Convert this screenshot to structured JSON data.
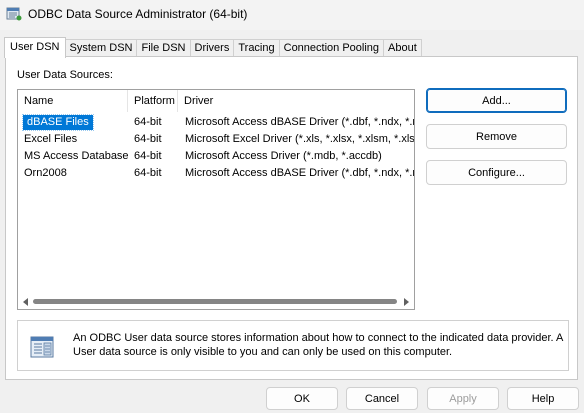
{
  "window": {
    "title": "ODBC Data Source Administrator (64-bit)",
    "icon": "odbc-admin-icon"
  },
  "tabs": [
    {
      "label": "User DSN",
      "active": true
    },
    {
      "label": "System DSN",
      "active": false
    },
    {
      "label": "File DSN",
      "active": false
    },
    {
      "label": "Drivers",
      "active": false
    },
    {
      "label": "Tracing",
      "active": false
    },
    {
      "label": "Connection Pooling",
      "active": false
    },
    {
      "label": "About",
      "active": false
    }
  ],
  "user_dsn": {
    "section_label": "User Data Sources:",
    "columns": {
      "name": "Name",
      "platform": "Platform",
      "driver": "Driver"
    },
    "rows": [
      {
        "name": "dBASE Files",
        "platform": "64-bit",
        "driver": "Microsoft Access dBASE Driver (*.dbf, *.ndx, *.m",
        "selected": true
      },
      {
        "name": "Excel Files",
        "platform": "64-bit",
        "driver": "Microsoft Excel Driver (*.xls, *.xlsx, *.xlsm, *.xlsb)",
        "selected": false
      },
      {
        "name": "MS Access Database",
        "platform": "64-bit",
        "driver": "Microsoft Access Driver (*.mdb, *.accdb)",
        "selected": false
      },
      {
        "name": "Orn2008",
        "platform": "64-bit",
        "driver": "Microsoft Access dBASE Driver (*.dbf, *.ndx, *.m",
        "selected": false
      }
    ],
    "buttons": {
      "add": "Add...",
      "remove": "Remove",
      "configure": "Configure..."
    },
    "info_text": "An ODBC User data source stores information about how to connect to the indicated data provider.   A User data source is only visible to you and can only be used on this computer."
  },
  "dialog_buttons": {
    "ok": "OK",
    "cancel": "Cancel",
    "apply": "Apply",
    "help": "Help"
  },
  "colors": {
    "selection": "#0078d7",
    "default_button_border": "#0f6cbd"
  }
}
